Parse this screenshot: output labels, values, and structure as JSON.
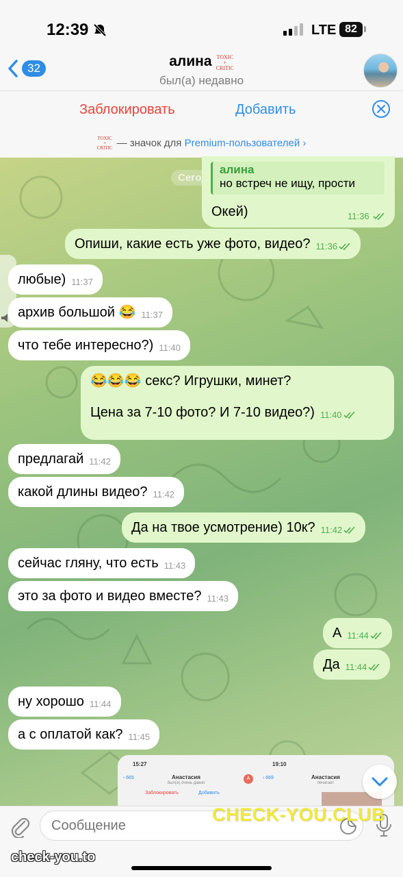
{
  "status": {
    "time": "12:39",
    "network": "LTE",
    "battery": "82"
  },
  "header": {
    "back_count": "32",
    "title": "алина",
    "badge_line1": "TOXIC",
    "badge_line2": "+",
    "badge_line3": "CRITIC",
    "subtitle": "был(а) недавно"
  },
  "actions": {
    "block": "Заблокировать",
    "add": "Добавить",
    "premium_prefix": "— значок для ",
    "premium_link": "Premium-пользователей ›"
  },
  "date_pill": "Сегодня",
  "messages": [
    {
      "dir": "out",
      "reply_name": "алина",
      "reply_text": "но встреч не ищу, прости",
      "text": "Окей)",
      "time": "11:36"
    },
    {
      "dir": "out",
      "text": "Опиши, какие есть уже фото, видео?",
      "time": "11:36"
    },
    {
      "dir": "in",
      "text": "любые)",
      "time": "11:37"
    },
    {
      "dir": "in",
      "text": "архив большой 😂",
      "time": "11:37"
    },
    {
      "dir": "in",
      "text": "что тебе интересно?)",
      "time": "11:40"
    },
    {
      "dir": "out",
      "text_line1": "😂😂😂 секс? Игрушки, минет?",
      "text_line2": "Цена за 7-10 фото? И 7-10 видео?)",
      "time": "11:40"
    },
    {
      "dir": "in",
      "text": "предлагай",
      "time": "11:42"
    },
    {
      "dir": "in",
      "text": "какой длины видео?",
      "time": "11:42"
    },
    {
      "dir": "out",
      "text": "Да на твое усмотрение) 10к?",
      "time": "11:42"
    },
    {
      "dir": "in",
      "text": "сейчас гляну, что есть",
      "time": "11:43"
    },
    {
      "dir": "in",
      "text": "это за фото и видео вместе?",
      "time": "11:43"
    },
    {
      "dir": "out",
      "text": "А",
      "time": "11:44"
    },
    {
      "dir": "out",
      "text": "Да",
      "time": "11:44"
    },
    {
      "dir": "in",
      "text": "ну хорошо",
      "time": "11:44"
    },
    {
      "dir": "in",
      "text": "а с оплатой как?",
      "time": "11:45"
    }
  ],
  "preview": {
    "left": {
      "time": "15:27",
      "name": "Анастасия",
      "subtitle": "был(а) очень давно",
      "back": "‹ 665",
      "block": "Заблокировать",
      "add": "Добавить",
      "avatar": "А"
    },
    "right": {
      "time": "19:10",
      "name": "Анастасия",
      "subtitle": "печатает",
      "back": "‹ 669"
    }
  },
  "input": {
    "placeholder": "Сообщение"
  },
  "watermarks": {
    "main": "CHECK-YOU.CLUB",
    "corner": "check-you.to"
  },
  "colors": {
    "accent": "#2f8de4",
    "danger": "#e5423c",
    "outgoing": "#e1f7cb",
    "incoming": "#ffffff",
    "check": "#4fae4e"
  }
}
